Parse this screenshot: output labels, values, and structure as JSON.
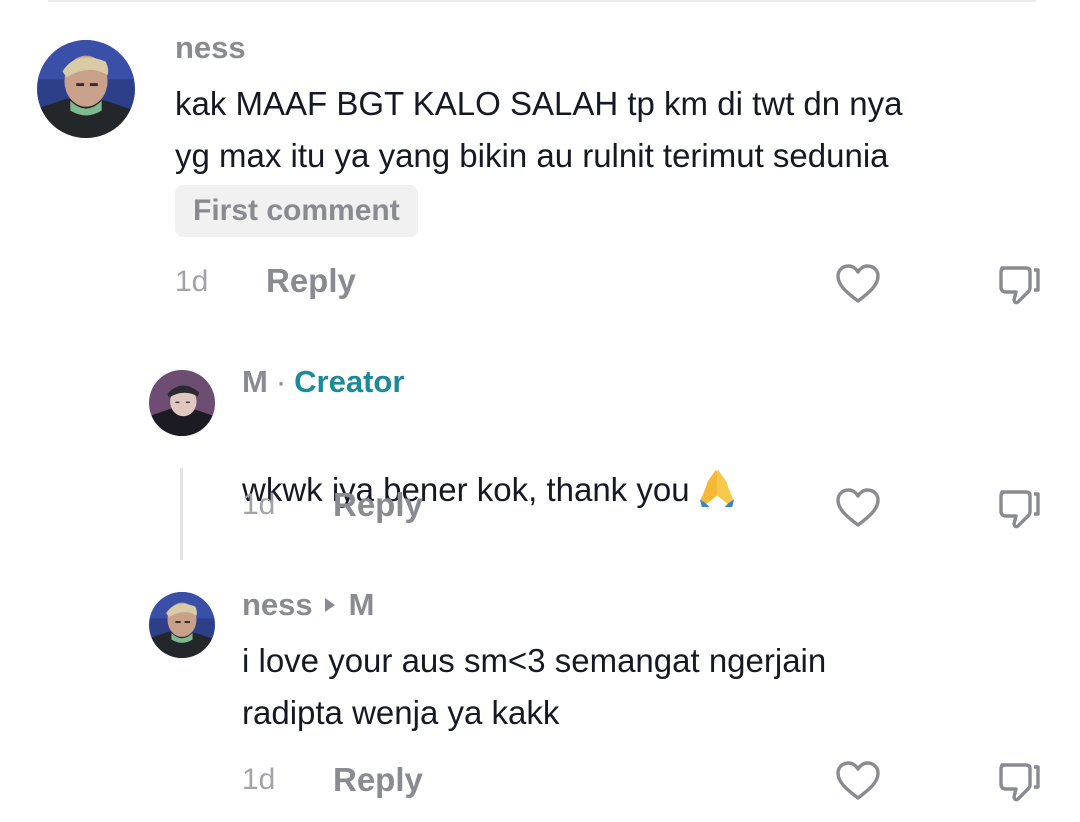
{
  "comments": [
    {
      "username": "ness",
      "text": "kak MAAF BGT KALO SALAH tp km di twt dn nya\nyg max itu ya yang bikin au rulnit terimut sedunia",
      "badge": "First comment",
      "time": "1d",
      "reply_label": "Reply"
    }
  ],
  "replies": [
    {
      "username": "M",
      "separator": "·",
      "role": "Creator",
      "text": "wkwk iya bener kok, thank you",
      "emoji": "folded-hands",
      "time": "1d",
      "reply_label": "Reply"
    },
    {
      "username": "ness",
      "reply_to": "M",
      "text": "i love your aus sm<3 semangat ngerjain\nradipta wenja ya kakk",
      "time": "1d",
      "reply_label": "Reply"
    }
  ],
  "icons": {
    "like": "heart-outline-icon",
    "dislike": "thumbs-down-outline-icon",
    "reply_to": "caret-right-icon"
  },
  "colors": {
    "creator": "#1b8a99",
    "muted": "#8a8b91",
    "text": "#161823"
  }
}
